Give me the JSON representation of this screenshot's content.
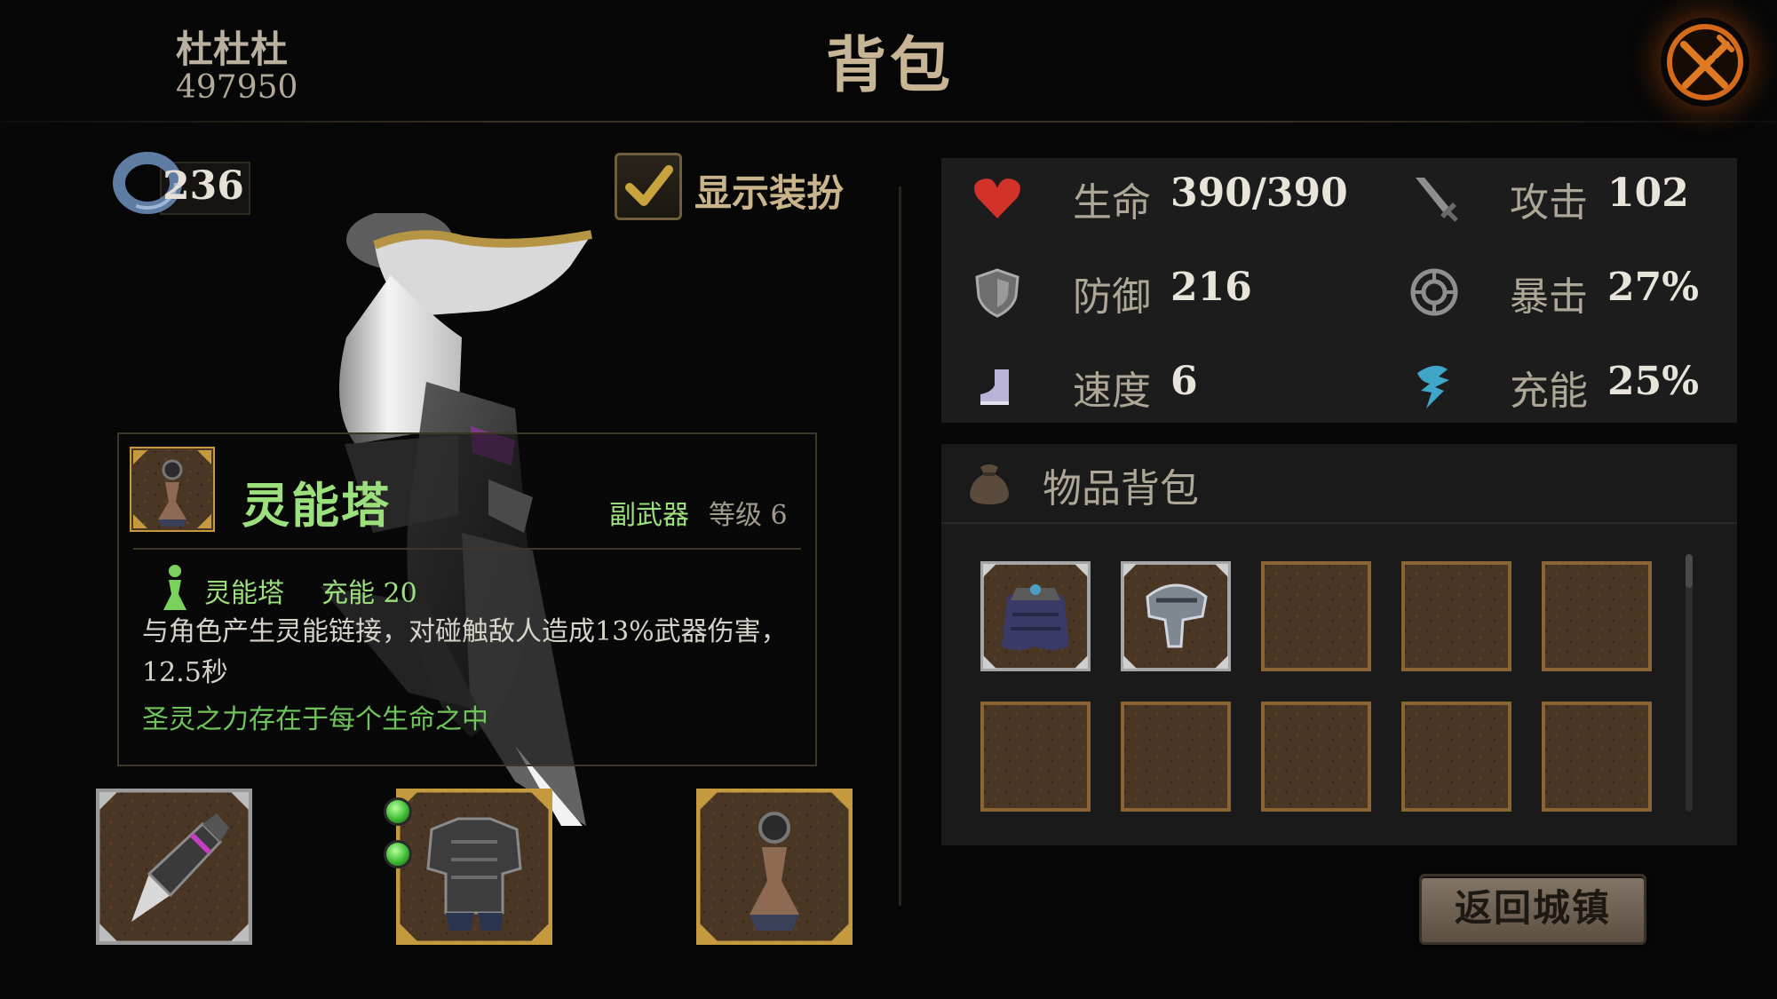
{
  "header": {
    "player_name": "杜杜杜",
    "player_id": "497950",
    "title": "背包"
  },
  "left": {
    "currency_value": "236",
    "show_outfit_label": "显示装扮",
    "show_outfit_checked": true
  },
  "tooltip": {
    "name": "灵能塔",
    "type": "副武器",
    "level": "等级 6",
    "skill_name": "灵能塔",
    "skill_charge": "充能 20",
    "description": "与角色产生灵能链接，对碰触敌人造成13%武器伤害，12.5秒",
    "lore": "圣灵之力存在于每个生命之中"
  },
  "equipment": [
    {
      "slot": "weapon",
      "icon": "spear-icon"
    },
    {
      "slot": "armor",
      "icon": "chest-armor-icon",
      "gems": 2
    },
    {
      "slot": "offhand",
      "icon": "spirit-tower-icon"
    }
  ],
  "stats": [
    {
      "label": "生命",
      "value": "390/390",
      "icon": "heart-icon",
      "color": "#d3322b"
    },
    {
      "label": "攻击",
      "value": "102",
      "icon": "sword-icon",
      "color": "#9a9a9a"
    },
    {
      "label": "防御",
      "value": "216",
      "icon": "shield-icon",
      "color": "#9a9a9a"
    },
    {
      "label": "暴击",
      "value": "27%",
      "icon": "crit-icon",
      "color": "#9a9a9a"
    },
    {
      "label": "速度",
      "value": "6",
      "icon": "boot-icon",
      "color": "#b9b3d6"
    },
    {
      "label": "充能",
      "value": "25%",
      "icon": "charge-icon",
      "color": "#3fa5c9"
    }
  ],
  "bag": {
    "title": "物品背包",
    "items": [
      {
        "icon": "cloak-icon"
      },
      {
        "icon": "helmet-icon"
      },
      {
        "icon": ""
      },
      {
        "icon": ""
      },
      {
        "icon": ""
      },
      {
        "icon": ""
      },
      {
        "icon": ""
      },
      {
        "icon": ""
      },
      {
        "icon": ""
      },
      {
        "icon": ""
      }
    ]
  },
  "buttons": {
    "return_town": "返回城镇"
  },
  "colors": {
    "background": "#070707",
    "gold_text": "#c8b596",
    "skill_green": "#9be07c",
    "lore_green": "#6fc45c",
    "panel": "#1c1c1c"
  }
}
